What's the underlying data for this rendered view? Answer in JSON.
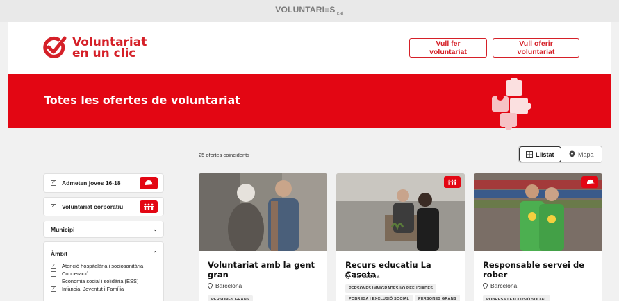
{
  "topbar": {
    "logo_main": "VOLUNTARI",
    "logo_mid": "≡S",
    "logo_sub": ".cat"
  },
  "brand": {
    "line1": "Voluntariat",
    "line2": "en un clic"
  },
  "header_buttons": {
    "do_volunteer": "Vull fer voluntariat",
    "offer_volunteer": "Vull oferir voluntariat"
  },
  "hero": {
    "title": "Totes les ofertes de voluntariat"
  },
  "results": {
    "count_text": "25 ofertes coincidents"
  },
  "view_toggle": {
    "list_label": "Llistat",
    "map_label": "Mapa"
  },
  "filters": {
    "young": {
      "label": "Admeten joves 16-18",
      "icon": "cap-icon"
    },
    "corporate": {
      "label": "Voluntariat corporatiu",
      "icon": "people-group-icon"
    },
    "municipality": {
      "label": "Municipi"
    },
    "ambit": {
      "label": "Àmbit",
      "items": [
        {
          "label": "Atenció hospitalària i sociosanitària",
          "checked": true
        },
        {
          "label": "Cooperació",
          "checked": false
        },
        {
          "label": "Economia social i solidària (ESS)",
          "checked": false
        },
        {
          "label": "Infància, Joventut i Família",
          "checked": true
        }
      ]
    }
  },
  "cards": [
    {
      "title": "Voluntariat amb la gent gran",
      "location": "Barcelona",
      "tags": [
        "PERSONES GRANS"
      ],
      "badge": ""
    },
    {
      "title": "Recurs educatiu La Caseta",
      "location": "Barcelona",
      "tags": [
        "PERSONES IMMIGRADES I/O REFUGIADES",
        "POBRESA I EXCLUSIÓ SOCIAL",
        "PERSONES GRANS"
      ],
      "badge": "people-group-icon"
    },
    {
      "title": "Responsable servei de rober",
      "location": "Barcelona",
      "tags": [
        "POBRESA I EXCLUSIÓ SOCIAL"
      ],
      "badge": "cap-icon"
    }
  ],
  "colors": {
    "brand_red": "#e30613",
    "button_red": "#d52028",
    "page_bg": "#f1f1f1"
  }
}
